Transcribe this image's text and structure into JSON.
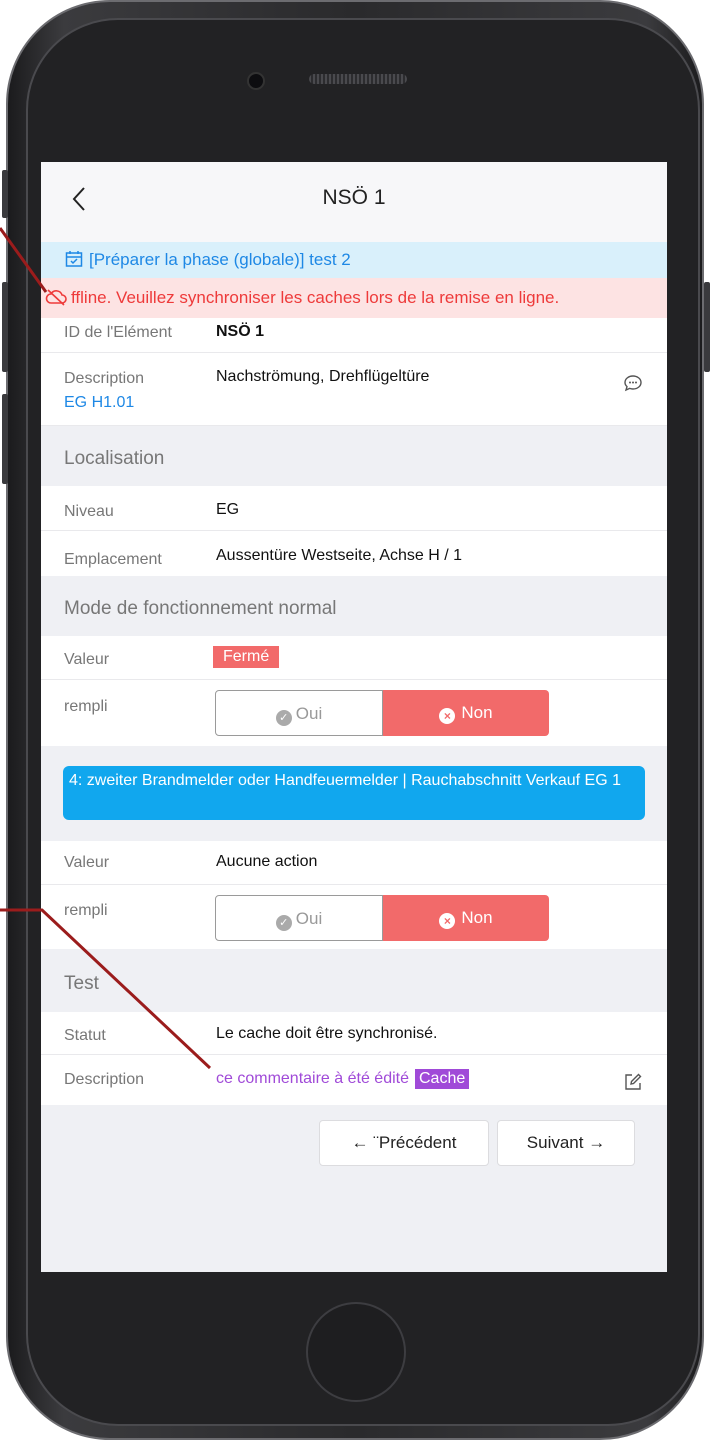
{
  "nav": {
    "back_icon": "chevron-left",
    "title": "NSÖ 1"
  },
  "phase_banner": {
    "text": "[Préparer la phase (globale)] test 2",
    "icon": "calendar-check-icon"
  },
  "offline_banner": {
    "text": "ffline. Veuillez synchroniser les caches lors de la remise en ligne.",
    "icon": "cloud-off-icon"
  },
  "element": {
    "id_label": "ID de l'Elément",
    "id_value": "NSÖ 1",
    "desc_label": "Description",
    "desc_sub": "EG H1.01",
    "desc_value": "Nachströmung, Drehflügeltüre"
  },
  "localisation": {
    "title": "Localisation",
    "niveau_label": "Niveau",
    "niveau_value": "EG",
    "emplacement_label": "Emplacement",
    "emplacement_value": "Aussentüre Westseite, Achse H / 1"
  },
  "mode": {
    "title": "Mode de fonctionnement normal",
    "valeur_label": "Valeur",
    "valeur_value": "Fermé",
    "rempli_label": "rempli",
    "oui": "Oui",
    "non": "Non"
  },
  "action": {
    "card_text": "4: zweiter Brandmelder oder Handfeuermelder | Rauchabschnitt Verkauf EG 1",
    "valeur_label": "Valeur",
    "valeur_value": "Aucune action",
    "rempli_label": "rempli",
    "oui": "Oui",
    "non": "Non"
  },
  "test": {
    "title": "Test",
    "statut_label": "Statut",
    "statut_value": "Le cache doit être synchronisé.",
    "desc_label": "Description",
    "desc_value": "ce commentaire à été édité",
    "cache_badge": "Cache"
  },
  "footer": {
    "prev": "← ¨Précédent",
    "next": "Suivant →"
  },
  "colors": {
    "accent_blue": "#1e88e5",
    "red": "#f26a6a",
    "purple": "#a04ad8",
    "annotation": "#9b1c1c"
  }
}
